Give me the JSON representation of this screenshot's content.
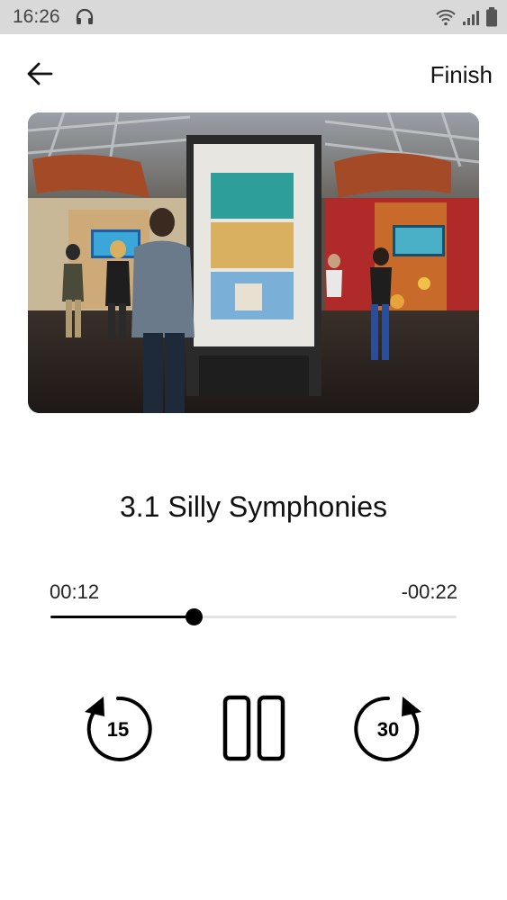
{
  "status_bar": {
    "time": "16:26"
  },
  "header": {
    "finish_label": "Finish"
  },
  "artwork": {
    "alt": "Exhibit photo"
  },
  "track": {
    "title": "3.1 Silly Symphonies"
  },
  "player": {
    "elapsed": "00:12",
    "remaining": "-00:22",
    "progress_fraction": 0.353
  },
  "controls": {
    "rewind_seconds": "15",
    "forward_seconds": "30"
  }
}
